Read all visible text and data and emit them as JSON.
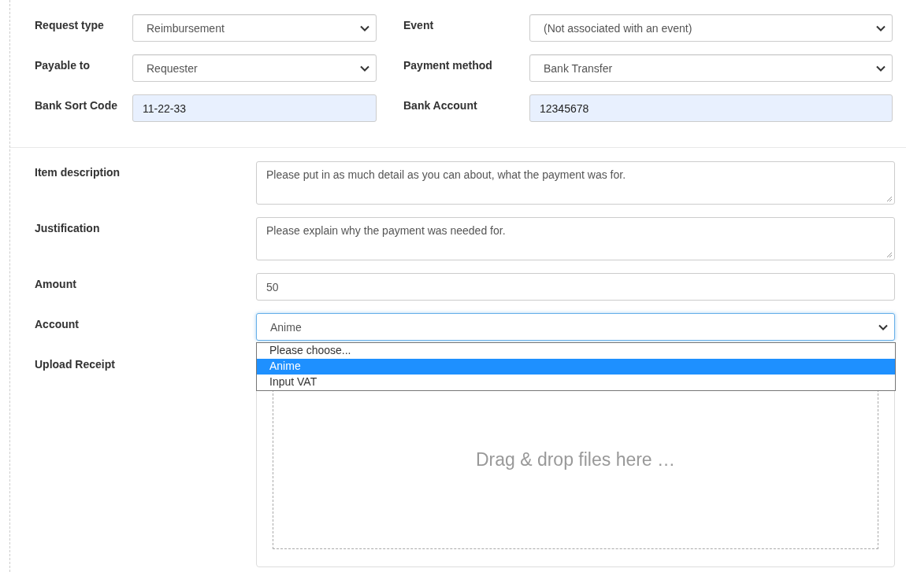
{
  "top_fields": [
    {
      "label": "Request type",
      "kind": "select",
      "value": "Reimbursement"
    },
    {
      "label": "Event",
      "kind": "select",
      "value": "(Not associated with an event)"
    },
    {
      "label": "Payable to",
      "kind": "select",
      "value": "Requester"
    },
    {
      "label": "Payment method",
      "kind": "select",
      "value": "Bank Transfer"
    },
    {
      "label": "Bank Sort Code",
      "kind": "input",
      "value": "11-22-33"
    },
    {
      "label": "Bank Account",
      "kind": "input",
      "value": "12345678"
    }
  ],
  "fields": [
    {
      "label": "Item description",
      "kind": "textarea",
      "placeholder": "Please put in as much detail as you can about, what the payment was for."
    },
    {
      "label": "Justification",
      "kind": "textarea",
      "placeholder": "Please explain why the payment was needed for."
    },
    {
      "label": "Amount",
      "kind": "input",
      "value": "50"
    },
    {
      "label": "Account",
      "kind": "select",
      "value": "Anime",
      "open": true,
      "options": [
        {
          "label": "Please choose...",
          "selected": false
        },
        {
          "label": "Anime",
          "selected": true
        },
        {
          "label": "Input VAT",
          "selected": false
        }
      ]
    },
    {
      "label": "Upload Receipt",
      "kind": "upload",
      "prompt": "Drag & drop files here …"
    }
  ]
}
